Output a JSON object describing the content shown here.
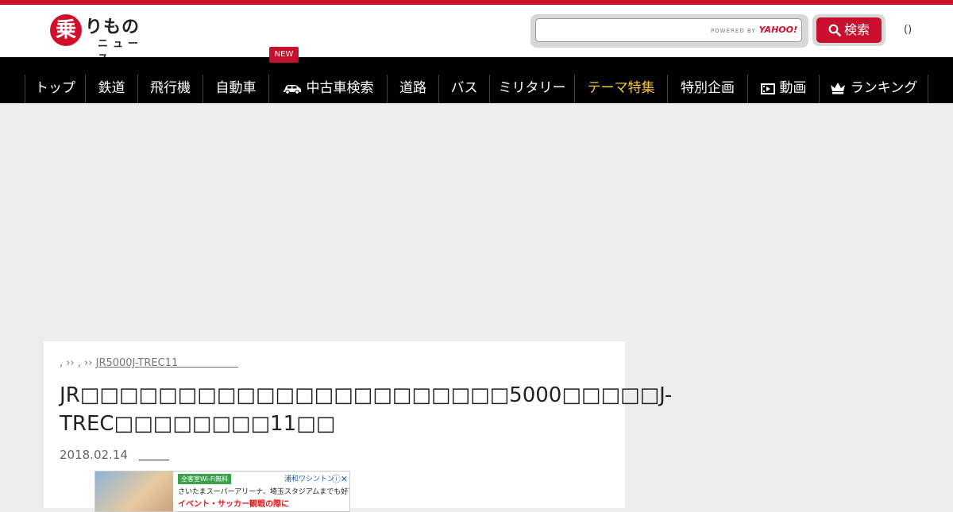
{
  "site": {
    "logo_kanji": "乗",
    "logo_kana": "りもの",
    "logo_sub": "ニュース"
  },
  "search": {
    "placeholder": "",
    "powered_by": "POWERED BY",
    "powered_brand": "YAHOO!",
    "button_label": "検索"
  },
  "header": {
    "paren": "()"
  },
  "nav": {
    "new_badge": "NEW",
    "items": [
      {
        "label": "トップ"
      },
      {
        "label": "鉄道"
      },
      {
        "label": "飛行機"
      },
      {
        "label": "自動車"
      },
      {
        "label": "中古車検索",
        "icon": "car-icon"
      },
      {
        "label": "道路"
      },
      {
        "label": "バス"
      },
      {
        "label": "ミリタリー"
      },
      {
        "label": "テーマ特集",
        "highlight": true
      },
      {
        "label": "特別企画"
      },
      {
        "label": "動画",
        "icon": "video-icon"
      },
      {
        "label": "ランキング",
        "icon": "crown-icon"
      }
    ]
  },
  "colors": {
    "accent": "#c8102e",
    "nav_bg": "#000000",
    "highlight": "#f5c542"
  },
  "article": {
    "breadcrumb_prefix": ", ›› , ››",
    "breadcrumb_link": "JR5000J-TREC11",
    "title": "JR□□□□□□□□□□□□□□□□□□□□□□5000□□□□□J-TREC□□□□□□□□11□□",
    "date": "2018.02.14"
  },
  "ad": {
    "tag": "全客室Wi-Fi無料",
    "brand": "浦和ワシントン",
    "line1": "さいたまスーパーアリーナ、埼玉スタジアムまでも好アクセス。",
    "line2": "イベント・サッカー観戦の際に"
  }
}
